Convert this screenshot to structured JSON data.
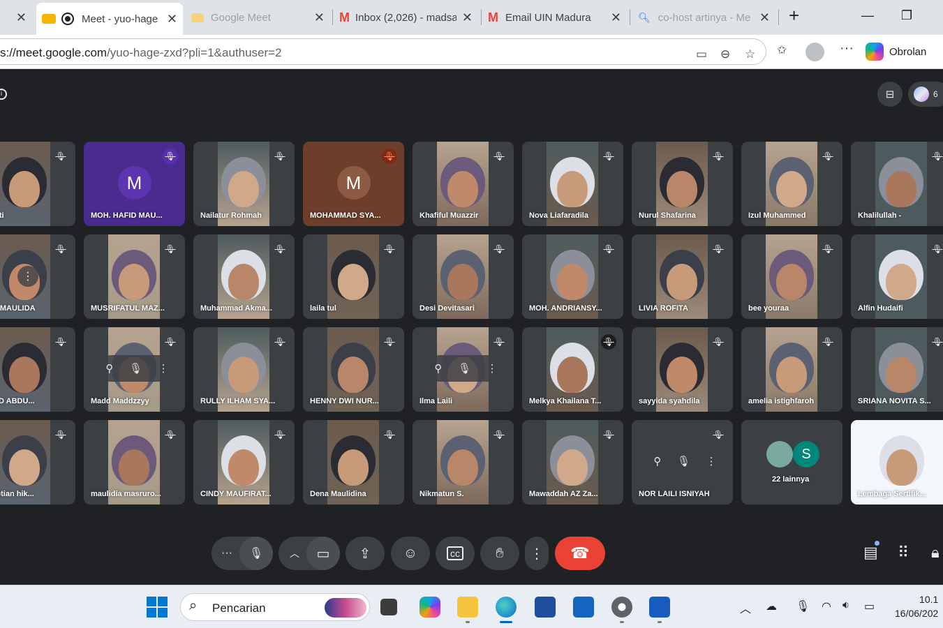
{
  "browser": {
    "tabs": [
      {
        "title": "Meet - yuo-hage",
        "active": true
      },
      {
        "title": "Google Meet",
        "active": false
      },
      {
        "title": "Inbox (2,026) - madsa",
        "active": false
      },
      {
        "title": "Email UIN Madura",
        "active": false
      },
      {
        "title": "co-host artinya - Me",
        "active": false
      }
    ],
    "url_prefix": "s://",
    "url_host": "meet.google.com",
    "url_path": "/yuo-hage-zxd?pli=1&authuser=2",
    "copilot_label": "Obrolan"
  },
  "meet": {
    "participant_count_short": "6",
    "tiles": [
      {
        "name": "o Wati",
        "kind": "video",
        "mic": "off"
      },
      {
        "name": "MOH. HAFID MAU...",
        "kind": "avatar",
        "initial": "M",
        "avatar_color": "#5e35b1",
        "bg": "#4a2c8f",
        "mic": "purple"
      },
      {
        "name": "Nailatur Rohmah",
        "kind": "video",
        "mic": "off"
      },
      {
        "name": "MOHAMMAD SYA...",
        "kind": "avatar",
        "initial": "M",
        "avatar_color": "#8d5a44",
        "bg": "#6d3f2a",
        "mic": "warn"
      },
      {
        "name": "Khafiful Muazzir",
        "kind": "video",
        "mic": "off"
      },
      {
        "name": "Nova Liafaradila",
        "kind": "video",
        "mic": "off"
      },
      {
        "name": "Nurul Shafarina",
        "kind": "video",
        "mic": "off"
      },
      {
        "name": "Izul Muhammed",
        "kind": "video",
        "mic": "off"
      },
      {
        "name": "Khalilullah -",
        "kind": "video",
        "mic": "off"
      },
      {
        "name": "NUR MAULIDA",
        "kind": "video",
        "mic": "off"
      },
      {
        "name": "MUSRIFATUL MAZ...",
        "kind": "video",
        "mic": "off"
      },
      {
        "name": "Muhammad Akma...",
        "kind": "video",
        "mic": "off"
      },
      {
        "name": "laila tul",
        "kind": "video",
        "mic": "off"
      },
      {
        "name": "Desi Devitasari",
        "kind": "video",
        "mic": "off"
      },
      {
        "name": "MOH. ANDRIANSY...",
        "kind": "video",
        "mic": "off"
      },
      {
        "name": "LIVIA ROFITA",
        "kind": "video",
        "mic": "off"
      },
      {
        "name": "bee youraa",
        "kind": "video",
        "mic": "off"
      },
      {
        "name": "Alfin Hudaifi",
        "kind": "video",
        "mic": "off"
      },
      {
        "name": "AMAD ABDU...",
        "kind": "video",
        "mic": "off"
      },
      {
        "name": "Madd Maddzzyy",
        "kind": "video",
        "mic": "off"
      },
      {
        "name": "RULLY ILHAM SYA...",
        "kind": "video",
        "mic": "off"
      },
      {
        "name": "HENNY DWI NUR...",
        "kind": "video",
        "mic": "off"
      },
      {
        "name": "Ilma Laili",
        "kind": "video",
        "mic": "off"
      },
      {
        "name": "Melkya Khailana T...",
        "kind": "video",
        "mic": "dark"
      },
      {
        "name": "sayyida syahdila",
        "kind": "video",
        "mic": "off"
      },
      {
        "name": "amelia istighfaroh",
        "kind": "video",
        "mic": "off"
      },
      {
        "name": "SRIANA NOVITA S...",
        "kind": "video",
        "mic": "off"
      },
      {
        "name": "a septian hik...",
        "kind": "video",
        "mic": "off"
      },
      {
        "name": "maulidia masruro...",
        "kind": "video",
        "mic": "off"
      },
      {
        "name": "CINDY MAUFIRAT...",
        "kind": "video",
        "mic": "off"
      },
      {
        "name": "Dena Maulidina",
        "kind": "video",
        "mic": "off"
      },
      {
        "name": "Nikmatun S.",
        "kind": "video",
        "mic": "off"
      },
      {
        "name": "Mawaddah AZ Za...",
        "kind": "video",
        "mic": "off"
      },
      {
        "name": "NOR LAILI ISNIYAH",
        "kind": "blank",
        "mic": "off"
      },
      {
        "name": "22 lainnya",
        "kind": "others",
        "initial": "S",
        "mic": "none"
      },
      {
        "name": "Lembaga Sertifik...",
        "kind": "video",
        "mic": "none"
      }
    ]
  },
  "taskbar": {
    "search_placeholder": "Pencarian",
    "time": "10.1",
    "date": "16/06/202"
  },
  "colors": {
    "meet_bg": "#202124",
    "tile_bg": "#3c4043",
    "end_call": "#ea4335",
    "others_teal": "#00897b"
  }
}
